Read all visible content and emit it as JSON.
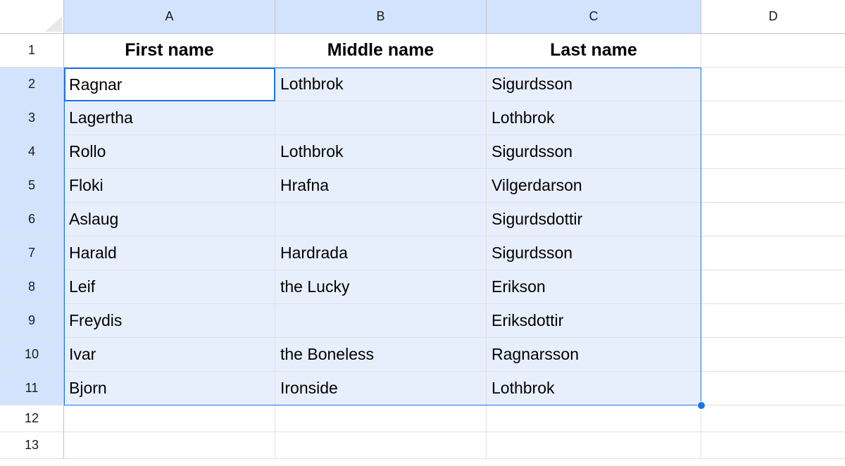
{
  "columns": [
    {
      "letter": "A",
      "selected": true
    },
    {
      "letter": "B",
      "selected": true
    },
    {
      "letter": "C",
      "selected": true
    },
    {
      "letter": "D",
      "selected": false
    }
  ],
  "rows": [
    {
      "num": "1",
      "selected": false
    },
    {
      "num": "2",
      "selected": true
    },
    {
      "num": "3",
      "selected": true
    },
    {
      "num": "4",
      "selected": true
    },
    {
      "num": "5",
      "selected": true
    },
    {
      "num": "6",
      "selected": true
    },
    {
      "num": "7",
      "selected": true
    },
    {
      "num": "8",
      "selected": true
    },
    {
      "num": "9",
      "selected": true
    },
    {
      "num": "10",
      "selected": true
    },
    {
      "num": "11",
      "selected": true
    },
    {
      "num": "12",
      "selected": false
    },
    {
      "num": "13",
      "selected": false
    }
  ],
  "headers": {
    "A": "First name",
    "B": "Middle name",
    "C": "Last name"
  },
  "data": [
    {
      "A": "Ragnar",
      "B": "Lothbrok",
      "C": "Sigurdsson"
    },
    {
      "A": "Lagertha",
      "B": "",
      "C": "Lothbrok"
    },
    {
      "A": "Rollo",
      "B": "Lothbrok",
      "C": "Sigurdsson"
    },
    {
      "A": "Floki",
      "B": "Hrafna",
      "C": "Vilgerdarson"
    },
    {
      "A": "Aslaug",
      "B": "",
      "C": "Sigurdsdottir"
    },
    {
      "A": "Harald",
      "B": "Hardrada",
      "C": "Sigurdsson"
    },
    {
      "A": "Leif",
      "B": "the Lucky",
      "C": "Erikson"
    },
    {
      "A": "Freydis",
      "B": "",
      "C": "Eriksdottir"
    },
    {
      "A": "Ivar",
      "B": "the Boneless",
      "C": "Ragnarsson"
    },
    {
      "A": "Bjorn",
      "B": "Ironside",
      "C": "Lothbrok"
    }
  ],
  "active_cell_value": "Ragnar"
}
